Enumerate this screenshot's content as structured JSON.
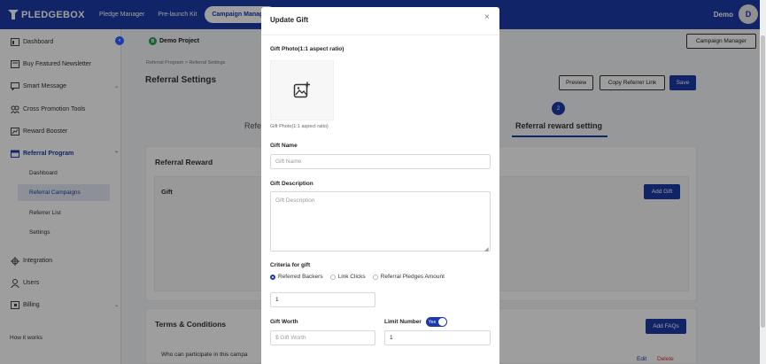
{
  "brand": {
    "name": "PLEDGEBOX"
  },
  "topnav": {
    "items": [
      {
        "label": "Pledge Manager"
      },
      {
        "label": "Pre-launch Kit"
      },
      {
        "label": "Campaign Manager"
      }
    ],
    "user_name": "Demo",
    "avatar_letter": "D"
  },
  "sidebar": {
    "items": [
      {
        "label": "Dashboard",
        "icon": "dashboard-icon"
      },
      {
        "label": "Buy Featured Newsletter",
        "icon": "newsletter-icon"
      },
      {
        "label": "Smart Message",
        "icon": "message-icon"
      },
      {
        "label": "Cross Promotion Tools",
        "icon": "people-icon"
      },
      {
        "label": "Reward Booster",
        "icon": "chart-icon"
      },
      {
        "label": "Referral Program",
        "icon": "calendar-icon"
      },
      {
        "label": "Integration",
        "icon": "move-icon"
      },
      {
        "label": "Users",
        "icon": "user-icon"
      },
      {
        "label": "Billing",
        "icon": "wallet-icon"
      }
    ],
    "sub_items": [
      {
        "label": "Dashboard"
      },
      {
        "label": "Referral Campaigns"
      },
      {
        "label": "Referrer List"
      },
      {
        "label": "Settings"
      }
    ],
    "how_it_works": "How it works"
  },
  "main": {
    "project_initial": "B",
    "project_name": "Demo Project",
    "campaign_manager_button": "Campaign Manager",
    "breadcrumb": "Referral Program  >  Referral Settings",
    "title": "Referral Settings",
    "preview_button": "Preview",
    "copy_link_button": "Copy Referrer Link",
    "save_button": "Save",
    "step_left_label": "Referr",
    "step_number": "2",
    "step_label": "Referral reward setting",
    "referral_reward_title": "Referral Reward",
    "gift_title": "Gift",
    "add_gift_button": "Add Gift",
    "terms_title": "Terms & Conditions",
    "add_faqs_button": "Add FAQs",
    "faq_question": "Who can participate in this campa",
    "edit_link": "Edit",
    "delete_link": "Delete"
  },
  "modal": {
    "title": "Update Gift",
    "close": "×",
    "gift_photo_label": "Gift Photo(1:1 aspect ratio)",
    "gift_photo_hint": "Gift Photo(1:1 aspect ratio)",
    "gift_name_label": "Gift Name",
    "gift_name_placeholder": "Gift Name",
    "gift_description_label": "Gift Description",
    "gift_description_placeholder": "Gift Description",
    "criteria_label": "Criteria for gift",
    "criteria_options": [
      {
        "label": "Referred Backers",
        "checked": true
      },
      {
        "label": "Link Clicks",
        "checked": false
      },
      {
        "label": "Referral Pledges Amount",
        "checked": false
      }
    ],
    "criteria_value": "1",
    "gift_worth_label": "Gift Worth",
    "gift_worth_placeholder": "$ Gift Worth",
    "limit_number_label": "Limit Number",
    "toggle_label": "Yes",
    "limit_value": "1"
  },
  "colors": {
    "primary": "#1c3aa9",
    "danger": "#dd3333"
  }
}
